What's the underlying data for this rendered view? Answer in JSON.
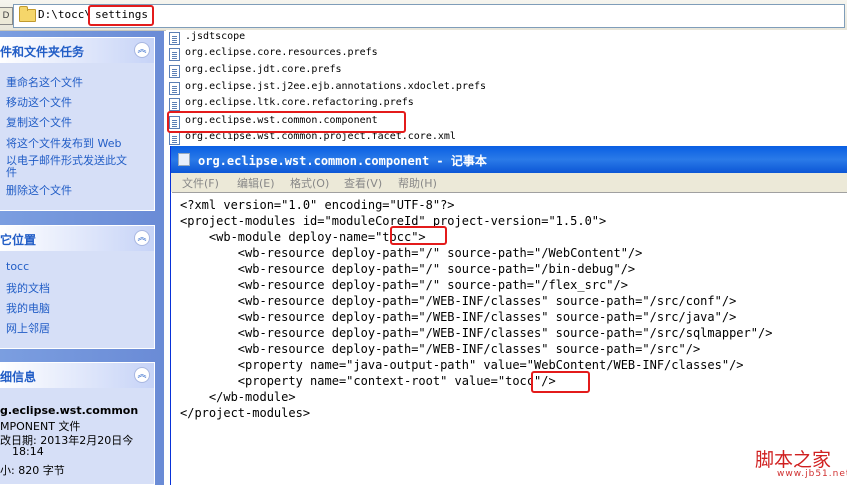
{
  "address": {
    "left_tab": "D",
    "path": "D:\\tocc\\",
    "highlighted": "settings"
  },
  "sidebar": {
    "tasks": {
      "title": "件和文件夹任务",
      "items": [
        "重命名这个文件",
        "移动这个文件",
        "复制这个文件",
        "将这个文件发布到 Web",
        "以电子邮件形式发送此文件",
        "删除这个文件"
      ]
    },
    "places": {
      "title": "它位置",
      "items": [
        "tocc",
        "我的文档",
        "我的电脑",
        "网上邻居"
      ]
    },
    "details": {
      "title": "细信息",
      "name": "g.eclipse.wst.common",
      "type": "MPONENT 文件",
      "modified": "改日期: 2013年2月20日今",
      "time": "18:14",
      "size": "小: 820 字节"
    }
  },
  "files": [
    ".jsdtscope",
    "org.eclipse.core.resources.prefs",
    "org.eclipse.jdt.core.prefs",
    "org.eclipse.jst.j2ee.ejb.annotations.xdoclet.prefs",
    "org.eclipse.ltk.core.refactoring.prefs",
    "org.eclipse.wst.common.component",
    "org.eclipse.wst.common.project.facet.core.xml"
  ],
  "notepad": {
    "title": "org.eclipse.wst.common.component - 记事本",
    "menu": [
      "文件(F)",
      "编辑(E)",
      "格式(O)",
      "查看(V)",
      "帮助(H)"
    ],
    "lines": [
      "<?xml version=\"1.0\" encoding=\"UTF-8\"?>",
      "<project-modules id=\"moduleCoreId\" project-version=\"1.5.0\">",
      "    <wb-module deploy-name=\"tocc\">",
      "        <wb-resource deploy-path=\"/\" source-path=\"/WebContent\"/>",
      "        <wb-resource deploy-path=\"/\" source-path=\"/bin-debug\"/>",
      "        <wb-resource deploy-path=\"/\" source-path=\"/flex_src\"/>",
      "        <wb-resource deploy-path=\"/WEB-INF/classes\" source-path=\"/src/conf\"/>",
      "        <wb-resource deploy-path=\"/WEB-INF/classes\" source-path=\"/src/java\"/>",
      "        <wb-resource deploy-path=\"/WEB-INF/classes\" source-path=\"/src/sqlmapper\"/>",
      "        <wb-resource deploy-path=\"/WEB-INF/classes\" source-path=\"/src\"/>",
      "        <property name=\"java-output-path\" value=\"WebContent/WEB-INF/classes\"/>",
      "        <property name=\"context-root\" value=\"tocc\"/>",
      "    </wb-module>",
      "</project-modules>"
    ]
  },
  "watermark": {
    "main": "脚本之家",
    "sub": "www.jb51.net"
  }
}
